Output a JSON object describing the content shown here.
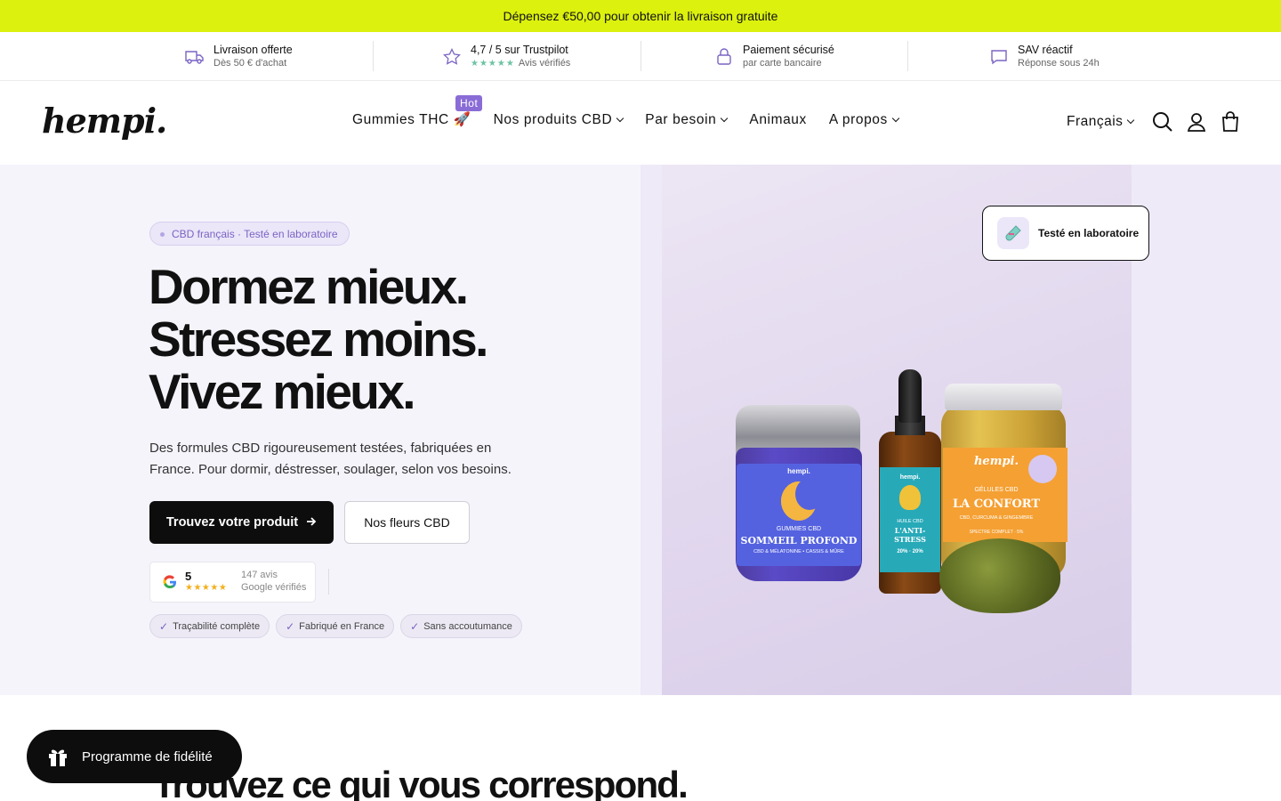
{
  "announcement": {
    "text": "Dépensez €50,00 pour obtenir la livraison gratuite"
  },
  "trust_bar": [
    {
      "icon": "truck-icon",
      "title": "Livraison offerte",
      "subtitle": "Dès 50 € d'achat"
    },
    {
      "icon": "star-icon",
      "title": "4,7 / 5 sur Trustpilot",
      "stars": "★★★★★",
      "subtitle": "Avis vérifiés"
    },
    {
      "icon": "lock-icon",
      "title": "Paiement sécurisé",
      "subtitle": "par carte bancaire"
    },
    {
      "icon": "chat-icon",
      "title": "SAV réactif",
      "subtitle": "Réponse sous 24h"
    }
  ],
  "header": {
    "logo": "hempi.",
    "nav": [
      {
        "label": "Gummies THC 🚀",
        "badge": "Hot",
        "has_dropdown": false
      },
      {
        "label": "Nos produits CBD",
        "has_dropdown": true
      },
      {
        "label": "Par besoin",
        "has_dropdown": true
      },
      {
        "label": "Animaux",
        "has_dropdown": false
      },
      {
        "label": "A propos",
        "has_dropdown": true
      }
    ],
    "language": "Français",
    "icons": [
      "search-icon",
      "account-icon",
      "cart-icon"
    ]
  },
  "hero": {
    "tag": "CBD français · Testé en laboratoire",
    "headline": [
      "Dormez mieux.",
      "Stressez moins.",
      "Vivez mieux."
    ],
    "subtitle": "Des formules CBD rigoureusement testées, fabriquées en France. Pour dormir, déstresser, soulager, selon vos besoins.",
    "cta_primary": "Trouvez votre produit",
    "cta_secondary": "Nos fleurs CBD",
    "review": {
      "score": "5",
      "stars": "★★★★★",
      "count": "147 avis",
      "label": "Google vérifiés"
    },
    "chips": [
      "Traçabilité complète",
      "Fabriqué en France",
      "Sans accoutumance"
    ],
    "lab_card": {
      "icon": "test-tube-icon",
      "text": "Testé en laboratoire"
    },
    "products": {
      "jar1": {
        "brand": "hempi.",
        "line1": "GUMMIES CBD",
        "name": "SOMMEIL PROFOND",
        "line3": "CBD & MÉLATONINE • CASSIS & MÛRE"
      },
      "dropper": {
        "brand": "hempi.",
        "line1": "HUILE CBD",
        "name": "L'ANTI-STRESS",
        "line3": "20% · 20%"
      },
      "jar3": {
        "brand": "hempi.",
        "line1": "GÉLULES CBD",
        "name": "LA CONFORT",
        "line3": "CBD, CURCUMA & GINGEMBRE",
        "line4": "SPECTRE COMPLET · 5%"
      }
    }
  },
  "section": {
    "title": "Trouvez ce qui vous correspond."
  },
  "loyalty": {
    "label": "Programme de fidélité",
    "icon": "gift-icon"
  }
}
